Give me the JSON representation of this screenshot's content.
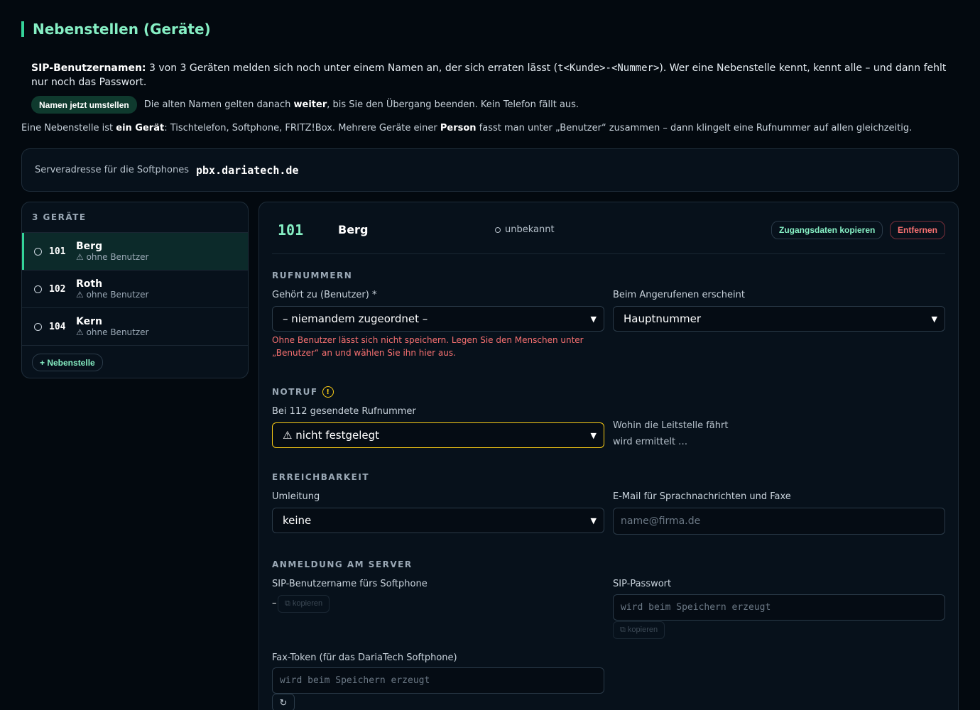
{
  "page": {
    "title": "Nebenstellen (Geräte)"
  },
  "sip_notice": {
    "lead": "SIP-Benutzernamen:",
    "text": "3 von 3 Geräten melden sich noch unter einem Namen an, der sich erraten lässt (",
    "pattern": "t<Kunde>-<Nummer>",
    "text_after": "). Wer eine Nebenstelle kennt, kennt alle – und dann fehlt nur noch das Passwort.",
    "button": "Namen jetzt umstellen",
    "hint_before": "Die alten Namen gelten danach ",
    "hint_bold": "weiter",
    "hint_after": ", bis Sie den Übergang beenden. Kein Telefon fällt aus."
  },
  "intro": {
    "p1": "Eine Nebenstelle ist ",
    "b1": "ein Gerät",
    "p2": ": Tischtelefon, Softphone, FRITZ!Box. Mehrere Geräte einer ",
    "b2": "Person",
    "p3": " fasst man unter „Benutzer“ zusammen – dann klingelt eine Rufnummer auf allen gleichzeitig."
  },
  "server": {
    "label": "Serveradresse für die Softphones",
    "value": "pbx.dariatech.de"
  },
  "devices": {
    "title": "3 GERÄTE",
    "items": [
      {
        "number": "101",
        "name": "Berg",
        "note": "⚠ ohne Benutzer",
        "active": true
      },
      {
        "number": "102",
        "name": "Roth",
        "note": "⚠ ohne Benutzer",
        "active": false
      },
      {
        "number": "104",
        "name": "Kern",
        "note": "⚠ ohne Benutzer",
        "active": false
      }
    ],
    "add_button": "+ Nebenstelle"
  },
  "detail": {
    "number": "101",
    "name": "Berg",
    "status": "unbekannt",
    "copy_button": "Zugangsdaten kopieren",
    "remove_button": "Entfernen",
    "rufnummern": {
      "title": "RUFNUMMERN",
      "user_label": "Gehört zu (Benutzer) *",
      "user_value": "– niemandem zugeordnet –",
      "user_error": "Ohne Benutzer lässt sich nicht speichern. Legen Sie den Menschen unter „Benutzer“ an und wählen Sie ihn hier aus.",
      "caller_label": "Beim Angerufenen erscheint",
      "caller_value": "Hauptnummer"
    },
    "notruf": {
      "title": "NOTRUF",
      "warn_icon": "!",
      "label": "Bei 112 gesendete Rufnummer",
      "value": "⚠ nicht festgelegt",
      "info_line1": "Wohin die Leitstelle fährt",
      "info_line2": "wird ermittelt …"
    },
    "erreichbarkeit": {
      "title": "ERREICHBARKEIT",
      "forward_label": "Umleitung",
      "forward_value": "keine",
      "email_label": "E-Mail für Sprachnachrichten und Faxe",
      "email_placeholder": "name@firma.de"
    },
    "anmeldung": {
      "title": "ANMELDUNG AM SERVER",
      "username_label": "SIP-Benutzername fürs Softphone",
      "username_value": "–",
      "copy_label": "⧉ kopieren",
      "password_label": "SIP-Passwort",
      "password_placeholder": "wird beim Speichern erzeugt",
      "fax_label": "Fax-Token (für das DariaTech Softphone)",
      "fax_placeholder": "wird beim Speichern erzeugt",
      "refresh_icon": "↻"
    }
  }
}
